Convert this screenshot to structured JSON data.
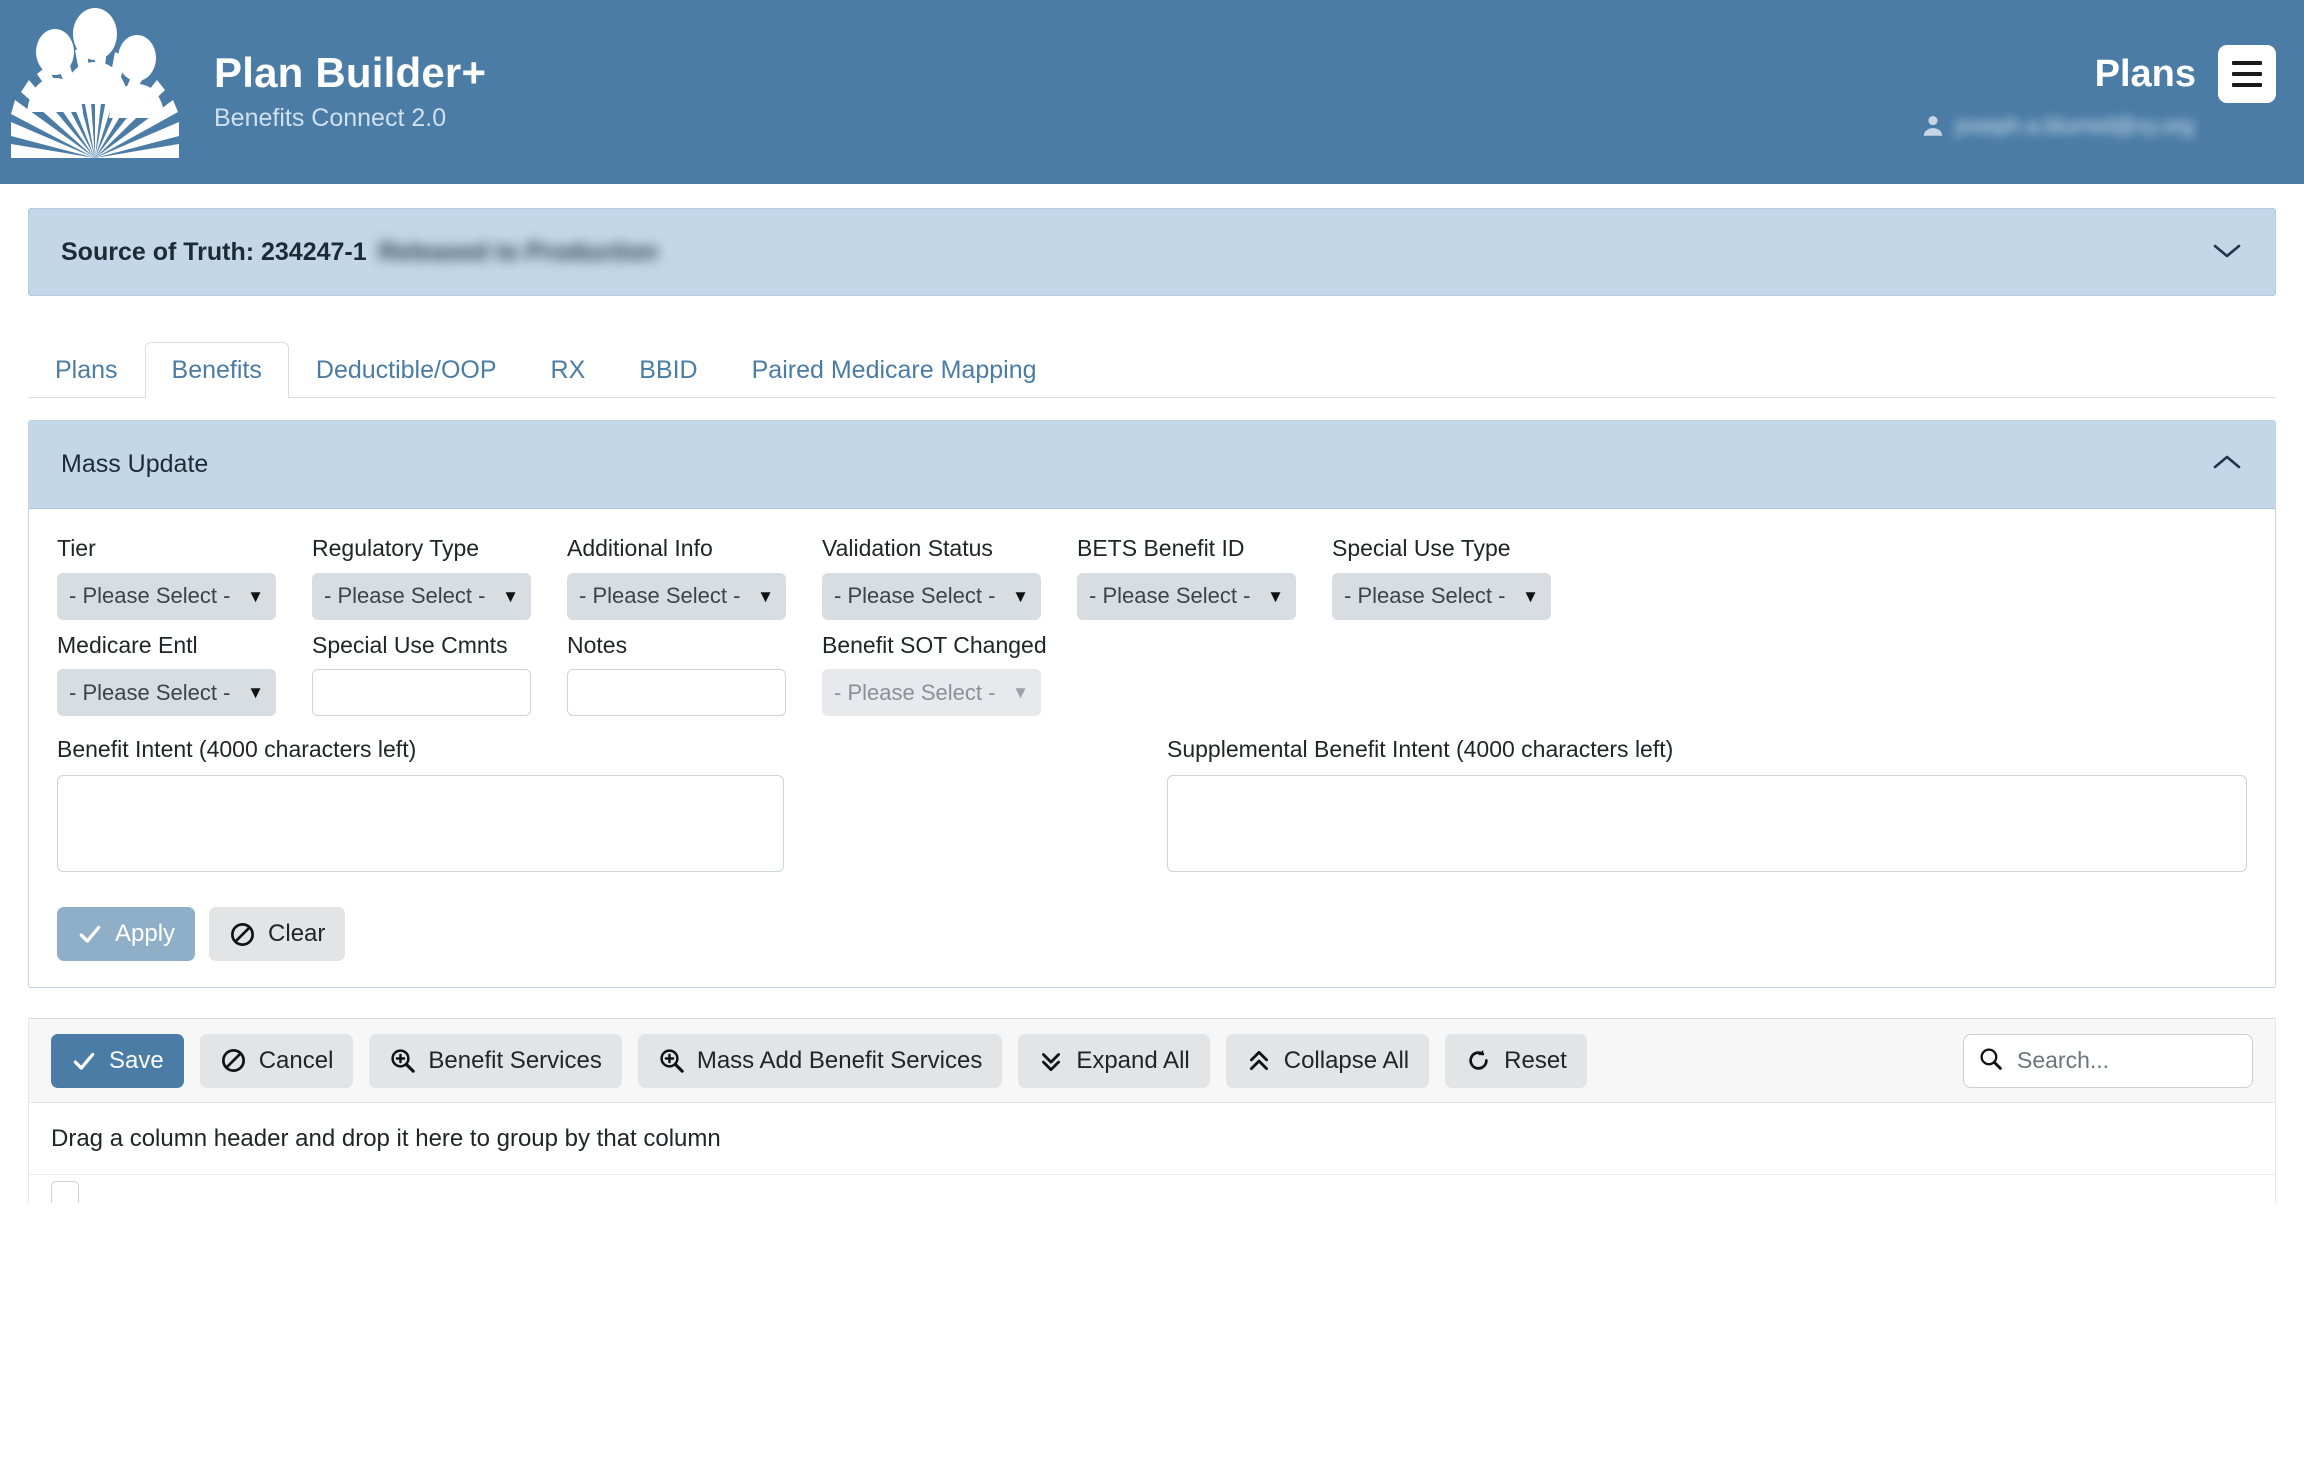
{
  "header": {
    "logo_icon": "three-people-sunburst-logo",
    "app_title": "Plan Builder+",
    "app_subtitle": "Benefits Connect 2.0",
    "section_label": "Plans",
    "menu_icon": "hamburger-menu-icon",
    "user_icon": "user-avatar-icon",
    "user_name": "joseph.a.blurred@xy.org",
    "brand_color": "#4a7ca6"
  },
  "source_of_truth": {
    "label": "Source of Truth: 234247-1",
    "status": "Released to Production",
    "chevron_icon": "chevron-down-icon",
    "panel_color": "#c3d7e8"
  },
  "tabs": [
    {
      "label": "Plans",
      "active": false
    },
    {
      "label": "Benefits",
      "active": true
    },
    {
      "label": "Deductible/OOP",
      "active": false
    },
    {
      "label": "RX",
      "active": false
    },
    {
      "label": "BBID",
      "active": false
    },
    {
      "label": "Paired Medicare Mapping",
      "active": false
    }
  ],
  "mass_update": {
    "title": "Mass Update",
    "chevron_icon": "chevron-up-icon",
    "placeholder_select": "- Please Select -",
    "fields_row1": [
      {
        "label": "Tier",
        "type": "select",
        "value": "- Please Select -",
        "disabled": false
      },
      {
        "label": "Regulatory Type",
        "type": "select",
        "value": "- Please Select -",
        "disabled": false
      },
      {
        "label": "Additional Info",
        "type": "select",
        "value": "- Please Select -",
        "disabled": false
      },
      {
        "label": "Validation Status",
        "type": "select",
        "value": "- Please Select -",
        "disabled": false
      },
      {
        "label": "BETS Benefit ID",
        "type": "select",
        "value": "- Please Select -",
        "disabled": false
      },
      {
        "label": "Special Use Type",
        "type": "select",
        "value": "- Please Select -",
        "disabled": false
      }
    ],
    "fields_row2": [
      {
        "label": "Medicare Entl",
        "type": "select",
        "value": "- Please Select -",
        "disabled": false
      },
      {
        "label": "Special Use Cmnts",
        "type": "text",
        "value": "",
        "placeholder": ""
      },
      {
        "label": "Notes",
        "type": "text",
        "value": "",
        "placeholder": ""
      },
      {
        "label": "Benefit SOT Changed",
        "type": "select",
        "value": "- Please Select -",
        "disabled": true
      }
    ],
    "intents": [
      {
        "label": "Benefit Intent (4000 characters left)",
        "value": "",
        "placeholder": ""
      },
      {
        "label": "Supplemental Benefit Intent (4000 characters left)",
        "value": "",
        "placeholder": ""
      }
    ],
    "apply_button": {
      "label": "Apply",
      "icon": "check-icon"
    },
    "clear_button": {
      "label": "Clear",
      "icon": "no-entry-icon"
    }
  },
  "grid_toolbar": {
    "buttons": [
      {
        "label": "Save",
        "icon": "check-icon",
        "style": "primary"
      },
      {
        "label": "Cancel",
        "icon": "no-entry-icon",
        "style": "default"
      },
      {
        "label": "Benefit Services",
        "icon": "zoom-in-icon",
        "style": "default"
      },
      {
        "label": "Mass Add Benefit Services",
        "icon": "zoom-in-icon",
        "style": "default"
      },
      {
        "label": "Expand All",
        "icon": "double-chevron-down-icon",
        "style": "default"
      },
      {
        "label": "Collapse All",
        "icon": "double-chevron-up-icon",
        "style": "default"
      },
      {
        "label": "Reset",
        "icon": "refresh-icon",
        "style": "default"
      }
    ],
    "search": {
      "placeholder": "Search...",
      "value": "",
      "icon": "search-icon"
    }
  },
  "grid": {
    "group_hint": "Drag a column header and drop it here to group by that column",
    "header_peek": [
      "",
      "",
      ""
    ]
  }
}
